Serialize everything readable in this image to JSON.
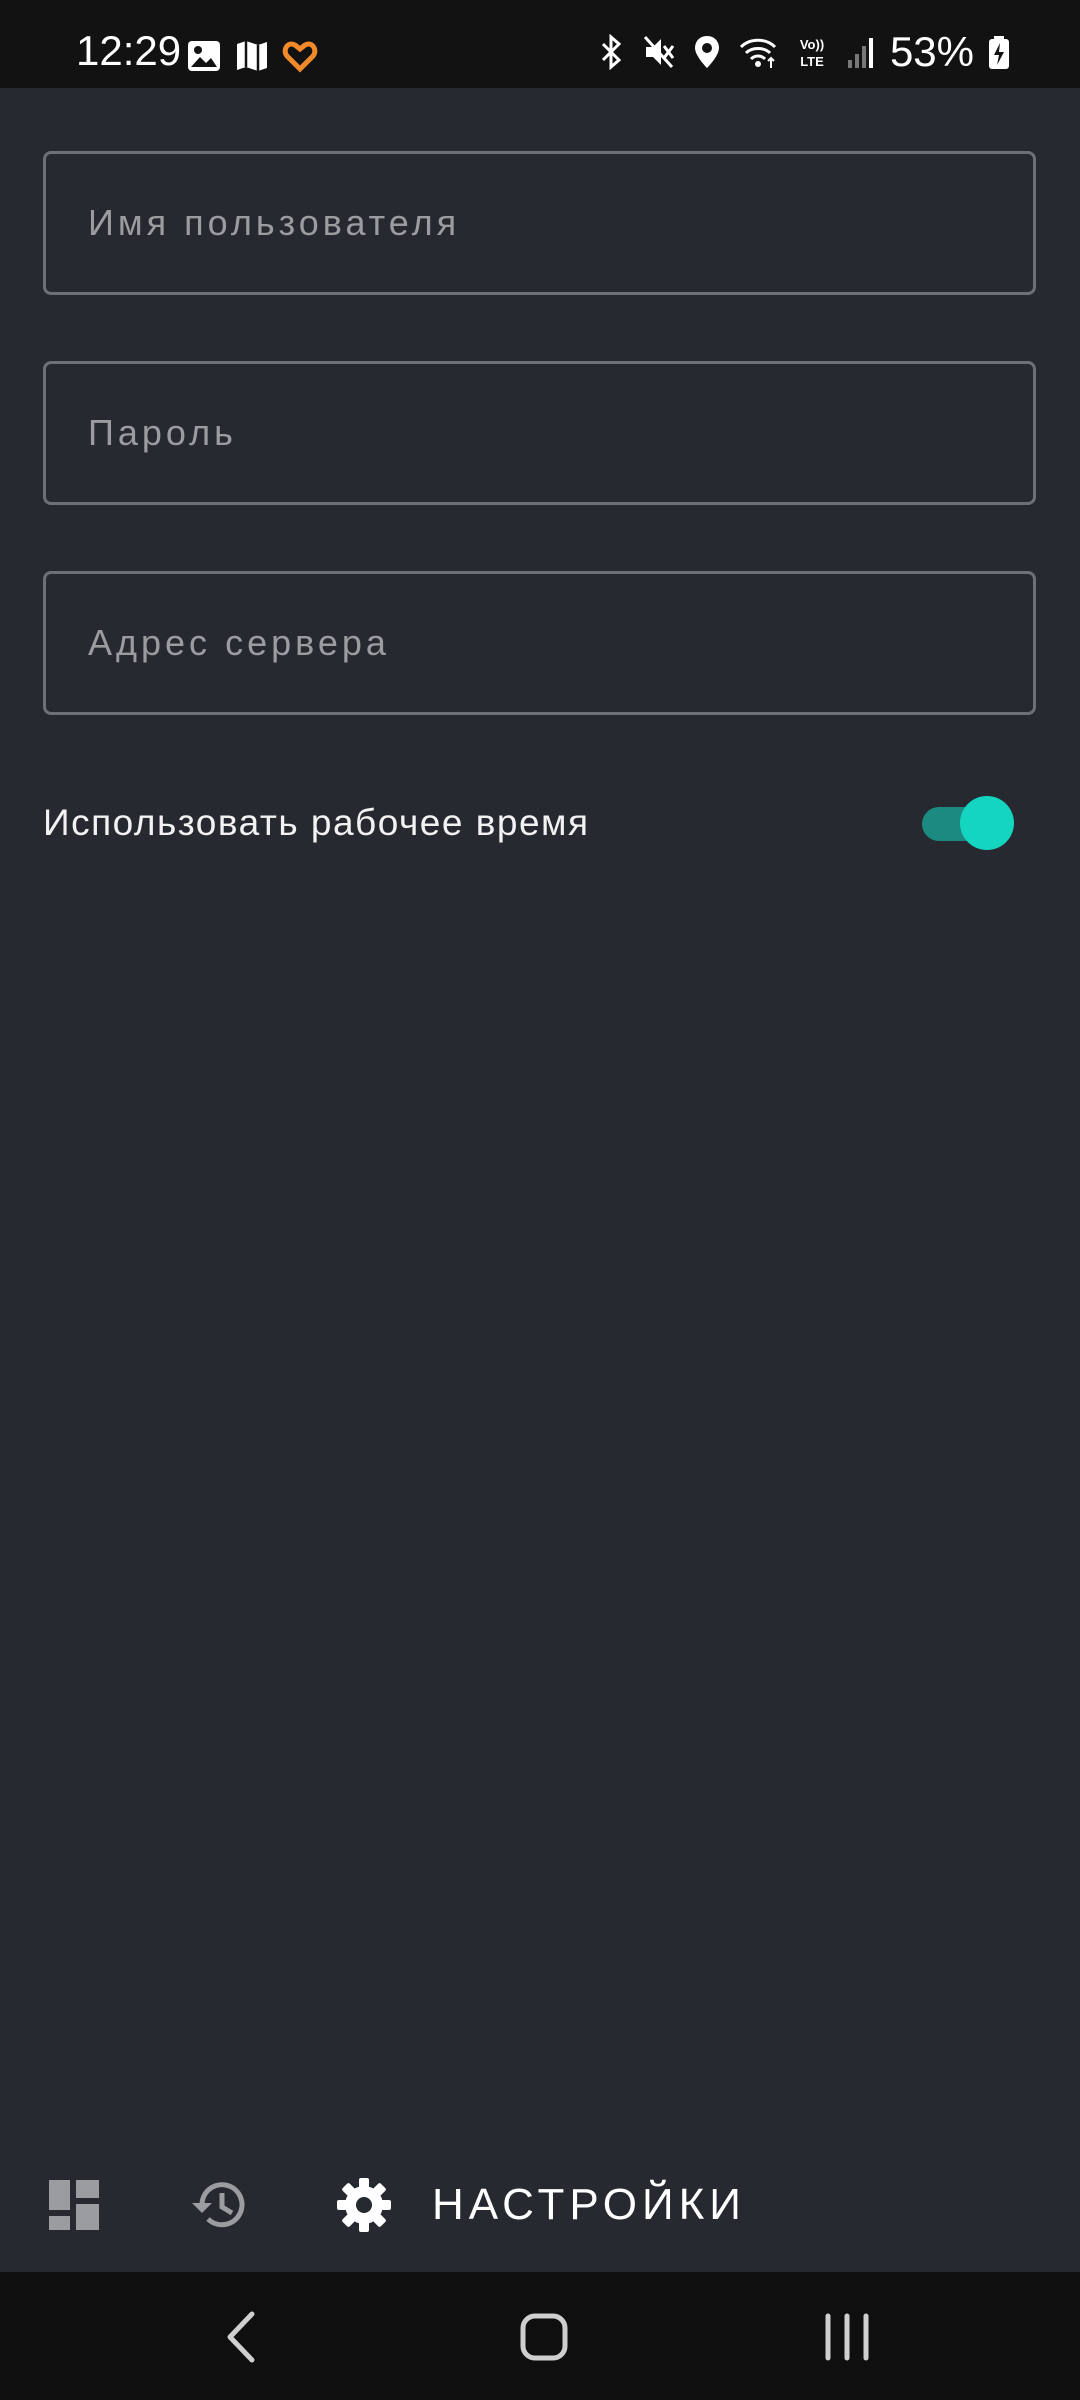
{
  "status_bar": {
    "time": "12:29",
    "battery": "53%",
    "left_icons": [
      "gallery-icon",
      "map-icon",
      "app-heart-icon"
    ],
    "right_icons": [
      "bluetooth-icon",
      "mute-icon",
      "location-icon",
      "wifi-icon",
      "volte-icon",
      "signal-icon",
      "battery-charging-icon"
    ]
  },
  "form": {
    "username_placeholder": "Имя пользователя",
    "password_placeholder": "Пароль",
    "server_placeholder": "Адрес сервера"
  },
  "toggle": {
    "label": "Использовать рабочее время",
    "enabled": true
  },
  "bottom_nav": {
    "settings_label": "НАСТРОЙКИ",
    "items": [
      "dashboard-icon",
      "history-icon",
      "gear-icon"
    ]
  },
  "colors": {
    "background": "#262930",
    "accent": "#14d6c0",
    "accent_track": "#1c8a80",
    "field_border": "#6d7075"
  }
}
